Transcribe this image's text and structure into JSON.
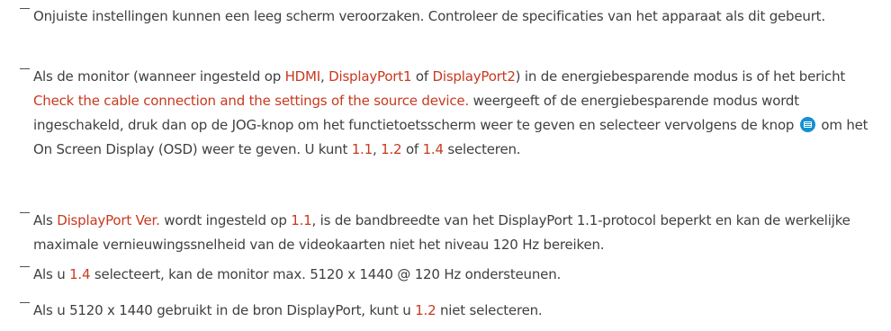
{
  "notes": [
    {
      "text": "Onjuiste instellingen kunnen een leeg scherm veroorzaken. Controleer de specificaties van het apparaat als dit gebeurt."
    },
    {
      "t1": "Als de monitor (wanneer ingesteld op ",
      "hdmi": "HDMI",
      "c1": ", ",
      "dp1": "DisplayPort1",
      "t2": " of ",
      "dp2": "DisplayPort2",
      "t3": ") in de energiebesparende modus is of het bericht ",
      "msg": "Check the cable connection and the settings of the source device.",
      "t4": " weergeeft of de energiebesparende modus wordt ingeschakeld, druk dan op de JOG-knop om het functietoetsscherm weer te geven en selecteer vervolgens de knop ",
      "icon": "osd-menu-icon",
      "t5": " om het On Screen Display (OSD) weer te geven. U kunt ",
      "v11": "1.1",
      "c2": ", ",
      "v12": "1.2",
      "t6": " of ",
      "v14": "1.4",
      "t7": " selecteren."
    },
    {
      "t1": "Als ",
      "dpver": "DisplayPort Ver.",
      "t2": " wordt ingesteld op ",
      "v11": "1.1",
      "t3": ", is de bandbreedte van het DisplayPort 1.1-protocol beperkt en kan de werkelijke maximale vernieuwingssnelheid van de videokaarten niet het niveau 120 Hz bereiken."
    },
    {
      "t1": "Als u ",
      "v14": "1.4",
      "t2": " selecteert, kan de monitor max. 5120 x 1440 @ 120 Hz ondersteunen."
    },
    {
      "t1": "Als u 5120 x 1440 gebruikt in de bron DisplayPort, kunt u ",
      "v12": "1.2",
      "t2": " niet selecteren."
    }
  ],
  "colors": {
    "text": "#404040",
    "highlight": "#c8391f",
    "icon": "#1590d2"
  }
}
